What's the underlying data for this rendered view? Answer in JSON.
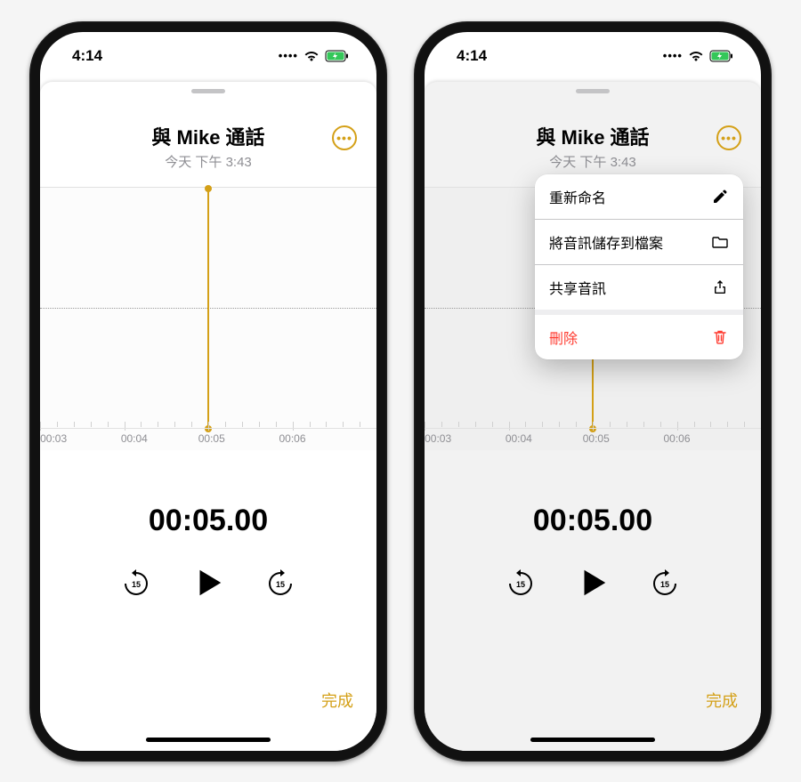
{
  "status": {
    "time": "4:14"
  },
  "recording": {
    "title": "與 Mike 通話",
    "subtitle": "今天 下午 3:43",
    "time_display": "00:05.00",
    "done_label": "完成",
    "skip_seconds": "15",
    "ruler": {
      "t0": "00:03",
      "t1": "00:04",
      "t2": "00:05",
      "t3": "00:06"
    }
  },
  "menu": {
    "rename": "重新命名",
    "save": "將音訊儲存到檔案",
    "share": "共享音訊",
    "delete": "刪除"
  }
}
